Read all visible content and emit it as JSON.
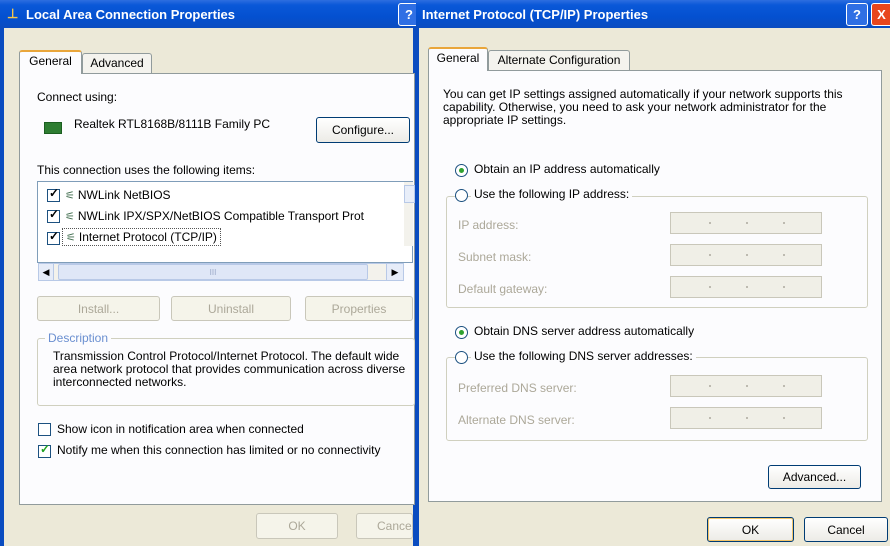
{
  "left": {
    "title": "Local Area Connection Properties",
    "help_glyph": "?",
    "tabs": [
      "General",
      "Advanced"
    ],
    "connect_using_label": "Connect using:",
    "adapter_name": "Realtek RTL8168B/8111B Family PC",
    "configure_label": "Configure...",
    "items_label": "This connection uses the following items:",
    "items": [
      {
        "label": "NWLink NetBIOS",
        "checked": true
      },
      {
        "label": "NWLink IPX/SPX/NetBIOS Compatible Transport Prot",
        "checked": true
      },
      {
        "label": "Internet Protocol (TCP/IP)",
        "checked": true
      }
    ],
    "scroll_thumb_glyph": "III",
    "buttons": {
      "install": "Install...",
      "uninstall": "Uninstall",
      "properties": "Properties"
    },
    "description_title": "Description",
    "description_text": "Transmission Control Protocol/Internet Protocol. The default wide area network protocol that provides communication across diverse interconnected networks.",
    "show_icon_label": "Show icon in notification area when connected",
    "show_icon_checked": false,
    "notify_label": "Notify me when this connection has limited or no connectivity",
    "notify_checked": true,
    "ok_label": "OK",
    "cancel_label": "Cance"
  },
  "right": {
    "title": "Internet Protocol (TCP/IP) Properties",
    "help_glyph": "?",
    "close_glyph": "X",
    "tabs": [
      "General",
      "Alternate Configuration"
    ],
    "intro": "You can get IP settings assigned automatically if your network supports this capability. Otherwise, you need to ask your network administrator for the appropriate IP settings.",
    "obtain_ip_label": "Obtain an IP address automatically",
    "use_ip_label": "Use the following IP address:",
    "ip_fields": [
      "IP address:",
      "Subnet mask:",
      "Default gateway:"
    ],
    "obtain_dns_label": "Obtain DNS server address automatically",
    "use_dns_label": "Use the following DNS server addresses:",
    "dns_fields": [
      "Preferred DNS server:",
      "Alternate DNS server:"
    ],
    "advanced_label": "Advanced...",
    "ok_label": "OK",
    "cancel_label": "Cancel"
  },
  "colors": {
    "titlebar": "#0a58d8",
    "face": "#ece9d8",
    "accent_tab": "#e9a63b",
    "close": "#e8461d"
  }
}
